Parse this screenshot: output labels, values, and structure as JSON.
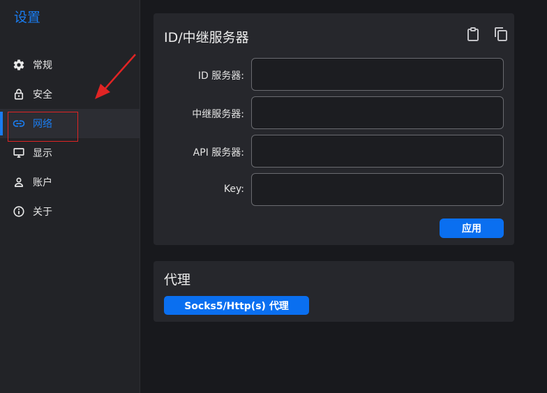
{
  "sidebar": {
    "title": "设置",
    "items": [
      {
        "label": "常规",
        "icon": "gear-icon"
      },
      {
        "label": "安全",
        "icon": "lock-icon"
      },
      {
        "label": "网络",
        "icon": "link-icon",
        "active": true
      },
      {
        "label": "显示",
        "icon": "monitor-icon"
      },
      {
        "label": "账户",
        "icon": "person-icon"
      },
      {
        "label": "关于",
        "icon": "info-icon"
      }
    ]
  },
  "server": {
    "title": "ID/中继服务器",
    "fields": [
      {
        "label": "ID 服务器:",
        "value": ""
      },
      {
        "label": "中继服务器:",
        "value": ""
      },
      {
        "label": "API 服务器:",
        "value": ""
      },
      {
        "label": "Key:",
        "value": ""
      }
    ],
    "apply_label": "应用"
  },
  "proxy": {
    "title": "代理",
    "button_label": "Socks5/Http(s) 代理"
  },
  "colors": {
    "accent": "#1a7cf0",
    "button": "#0a6ff0",
    "annotation": "#e02424"
  }
}
